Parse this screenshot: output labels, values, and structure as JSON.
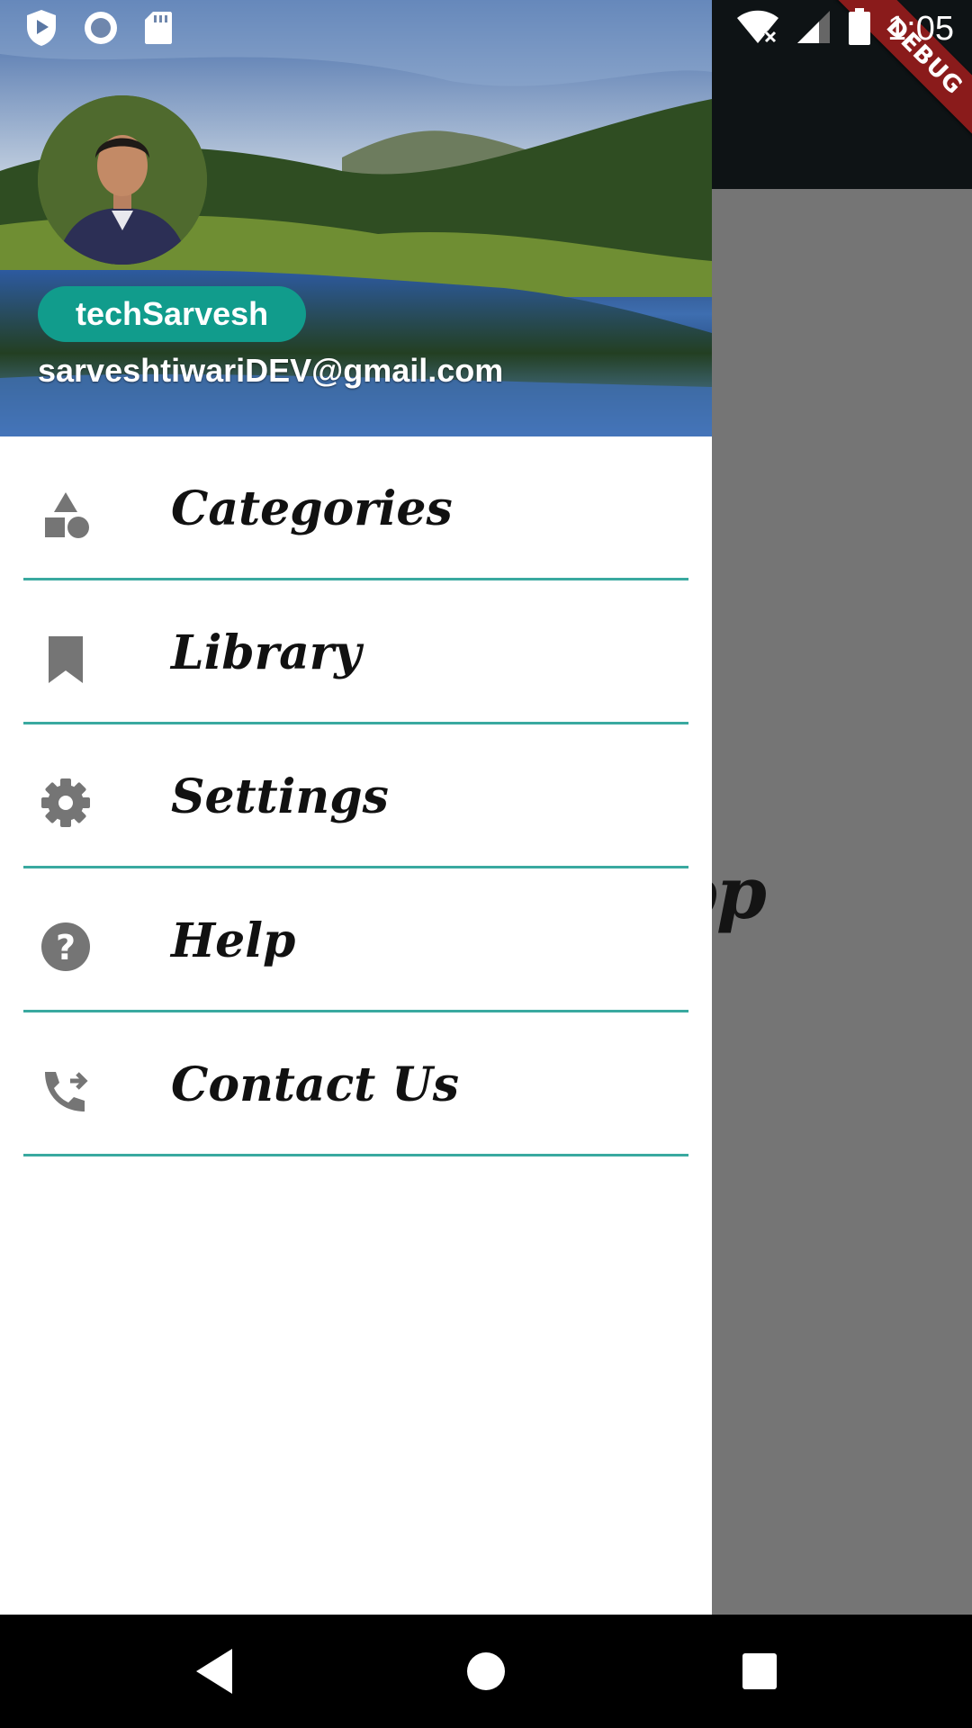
{
  "status_bar": {
    "time": "1:05",
    "left_icons": [
      "play-protect-icon",
      "circle-icon",
      "sd-card-icon"
    ],
    "right_icons": [
      "wifi-off-icon",
      "signal-icon",
      "battery-icon"
    ]
  },
  "background_app": {
    "title_fragment": "App",
    "debug_banner": "DEBUG"
  },
  "drawer": {
    "header": {
      "name": "techSarvesh",
      "email": "sarveshtiwariDEV@gmail.com"
    },
    "items": [
      {
        "label": "Categories",
        "icon": "category-icon"
      },
      {
        "label": "Library",
        "icon": "bookmark-icon"
      },
      {
        "label": "Settings",
        "icon": "gear-icon"
      },
      {
        "label": "Help",
        "icon": "help-icon"
      },
      {
        "label": "Contact Us",
        "icon": "phone-forwarded-icon"
      }
    ]
  },
  "colors": {
    "accent": "#119c8c",
    "divider": "#3aa9a0",
    "icon": "#757575",
    "scrim": "#737373"
  },
  "nav_bar": {
    "buttons": [
      "back-icon",
      "home-icon",
      "recents-icon"
    ]
  }
}
